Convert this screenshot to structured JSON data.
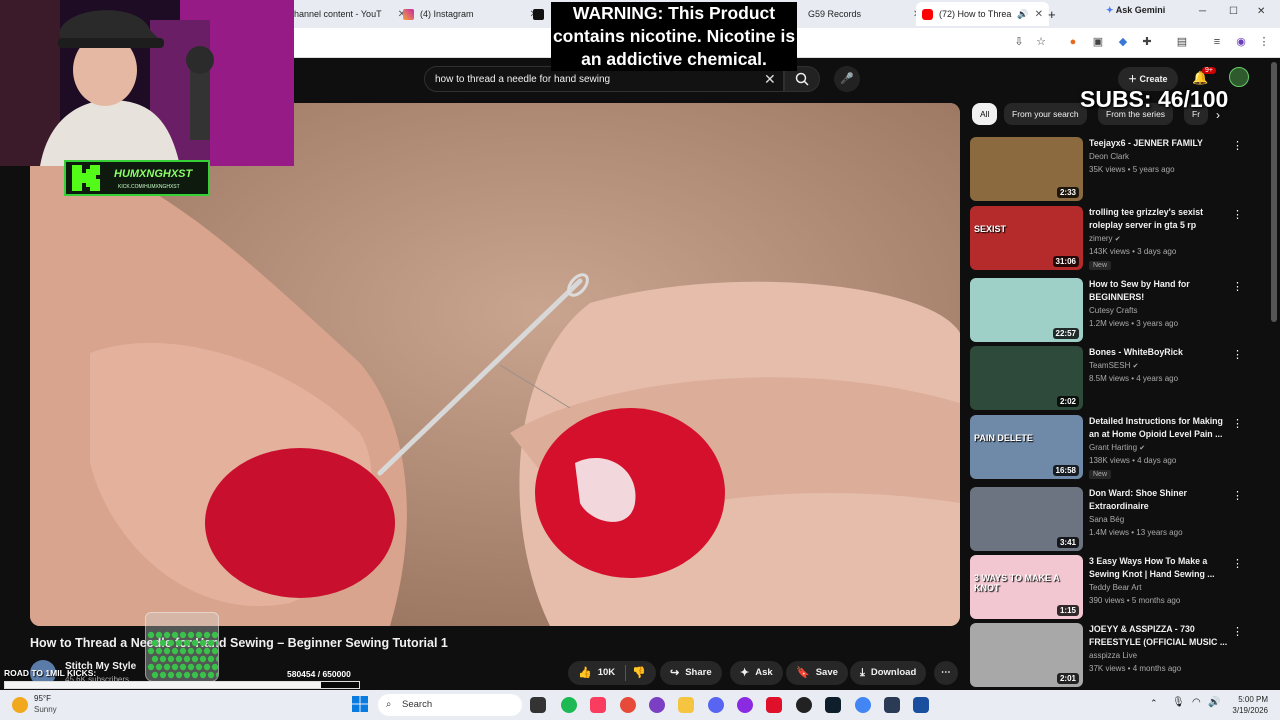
{
  "browser": {
    "tabs": [
      {
        "label": "hannel content - YouT"
      },
      {
        "label": "(4) Instagram"
      },
      {
        "label": "G59 Records"
      },
      {
        "label": "(72) How to Threa"
      }
    ],
    "ask_gemini": "Ask Gemini"
  },
  "youtube": {
    "search_value": "how to thread a needle for hand sewing",
    "create_label": "Create",
    "notif_badge": "9+"
  },
  "video": {
    "title": "How to Thread a Needle for Hand Sewing – Beginner Sewing Tutorial 1",
    "channel": "Stitch My Style",
    "subscribers": "45.6K subscribers",
    "likes": "10K",
    "share": "Share",
    "ask": "Ask",
    "save": "Save",
    "download": "Download"
  },
  "chips": [
    "All",
    "From your search",
    "From the series",
    "Fr"
  ],
  "recommendations": [
    {
      "title": "Teejayx6 - JENNER FAMILY",
      "channel": "Deon Clark",
      "meta": "35K views • 5 years ago",
      "duration": "2:33",
      "new": false,
      "verified": false,
      "color": "#8a6a3e"
    },
    {
      "title": "trolling tee grizzley's sexist roleplay server in gta 5 rp",
      "channel": "zimery",
      "meta": "143K views • 3 days ago",
      "duration": "31:06",
      "new": true,
      "verified": true,
      "color": "#b52a2a",
      "overlay": "SEXIST"
    },
    {
      "title": "How to Sew by Hand for BEGINNERS!",
      "channel": "Cutesy Crafts",
      "meta": "1.2M views • 3 years ago",
      "duration": "22:57",
      "new": false,
      "verified": false,
      "color": "#9ed0c8"
    },
    {
      "title": "Bones - WhiteBoyRick",
      "channel": "TeamSESH",
      "meta": "8.5M views • 4 years ago",
      "duration": "2:02",
      "new": false,
      "verified": true,
      "color": "#2e4a3a"
    },
    {
      "title": "Detailed Instructions for Making an at Home Opioid Level Pain ...",
      "channel": "Grant Harting",
      "meta": "138K views • 4 days ago",
      "duration": "16:58",
      "new": true,
      "verified": true,
      "color": "#6f8aa8",
      "overlay": "PAIN DELETE"
    },
    {
      "title": "Don Ward: Shoe Shiner Extraordinaire",
      "channel": "Sana Bég",
      "meta": "1.4M views • 13 years ago",
      "duration": "3:41",
      "new": false,
      "verified": false,
      "color": "#6b7480"
    },
    {
      "title": "3 Easy Ways How To Make a Sewing Knot | Hand Sewing ...",
      "channel": "Teddy Bear Art",
      "meta": "390 views • 5 months ago",
      "duration": "1:15",
      "new": false,
      "verified": false,
      "color": "#f2c7d2",
      "overlay": "3 WAYS TO MAKE A KNOT"
    },
    {
      "title": "JOEYY & ASSPIZZA - 730 FREESTYLE (OFFICIAL MUSIC ...",
      "channel": "asspizza Live",
      "meta": "37K views • 4 months ago",
      "duration": "2:01",
      "new": false,
      "verified": false,
      "color": "#a8a8a8"
    }
  ],
  "overlay": {
    "warning": "WARNING: This Product contains nicotine. Nicotine is an addictive chemical.",
    "subs": "SUBS: 46/100",
    "kick_name": "HUMXNGHXST",
    "kick_url": "KICK.COM/HUMXNGHXST",
    "road_label": "ROAD TO 1MIL KICKS:",
    "road_count": "580454  / 650000",
    "road_progress": 0.893
  },
  "taskbar": {
    "temp": "95°F",
    "weather": "Sunny",
    "search": "Search",
    "time": "5:00 PM",
    "date": "3/19/2026"
  },
  "colors": {
    "yt_bg": "#0f0f0f",
    "kick_green": "#35d035",
    "youtube_red": "#ff0000"
  }
}
